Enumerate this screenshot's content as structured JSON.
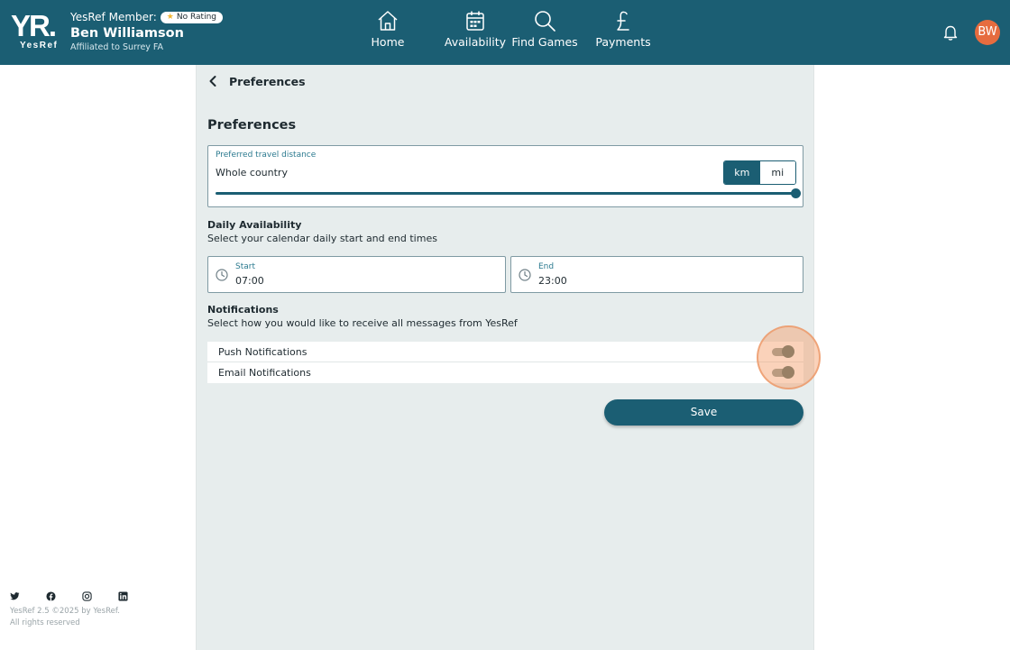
{
  "header": {
    "logo": {
      "mark": "YR.",
      "word": "YesRef"
    },
    "member_label": "YesRef Member:",
    "rating_badge": "No Rating",
    "name": "Ben Williamson",
    "affiliation": "Affiliated to Surrey FA",
    "nav": [
      {
        "label": "Home",
        "icon": "home-icon"
      },
      {
        "label": "Availability",
        "icon": "calendar-icon"
      },
      {
        "label": "Find Games",
        "icon": "search-icon"
      },
      {
        "label": "Payments",
        "icon": "pound-icon"
      }
    ],
    "avatar_initials": "BW"
  },
  "page": {
    "back_title": "Preferences",
    "section_title": "Preferences"
  },
  "travel": {
    "label": "Preferred travel distance",
    "value": "Whole country",
    "unit_km": "km",
    "unit_mi": "mi",
    "selected_unit": "km",
    "slider_fraction": 1.0
  },
  "daily": {
    "heading": "Daily Availability",
    "description": "Select your calendar daily start and end times",
    "start_label": "Start",
    "start_value": "07:00",
    "end_label": "End",
    "end_value": "23:00"
  },
  "notifications": {
    "heading": "Notifications",
    "description": "Select how you would like to receive all messages from YesRef",
    "items": [
      {
        "label": "Push Notifications",
        "enabled": true
      },
      {
        "label": "Email Notifications",
        "enabled": true
      }
    ]
  },
  "save_label": "Save",
  "footer": {
    "social": [
      "twitter-icon",
      "facebook-icon",
      "instagram-icon",
      "linkedin-icon"
    ],
    "version": "YesRef 2.5 ©2025 by YesRef.",
    "rights": "All rights reserved"
  },
  "colors": {
    "primary": "#1b5e73",
    "panel": "#e7eded",
    "avatar": "#e66c3f",
    "label_accent": "#2b7a8f"
  }
}
